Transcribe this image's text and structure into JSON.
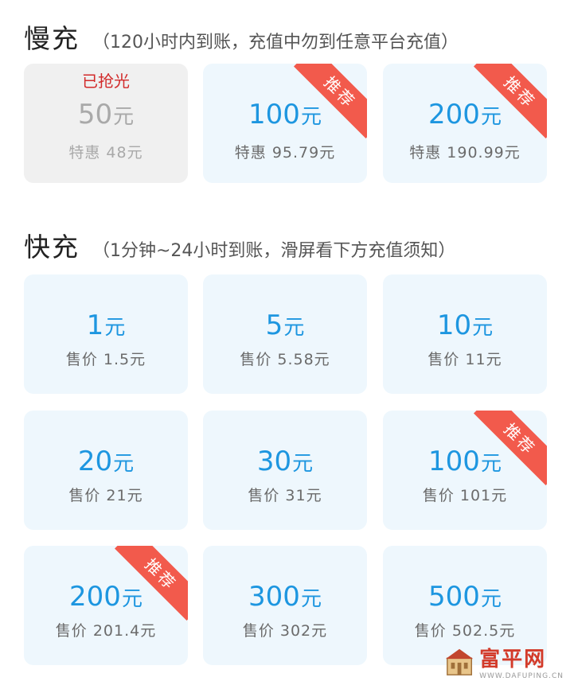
{
  "slow": {
    "title": "慢充",
    "note": "（120小时内到账，充值中勿到任意平台充值）",
    "cards": [
      {
        "amount": "50",
        "unit": "元",
        "price": "特惠  48元",
        "badge": "已抢光"
      },
      {
        "amount": "100",
        "unit": "元",
        "price": "特惠  95.79元",
        "ribbon": "推荐"
      },
      {
        "amount": "200",
        "unit": "元",
        "price": "特惠  190.99元",
        "ribbon": "推荐"
      }
    ]
  },
  "fast": {
    "title": "快充",
    "note": "（1分钟~24小时到账，滑屏看下方充值须知）",
    "cards": [
      {
        "amount": "1",
        "unit": "元",
        "price": "售价  1.5元"
      },
      {
        "amount": "5",
        "unit": "元",
        "price": "售价  5.58元"
      },
      {
        "amount": "10",
        "unit": "元",
        "price": "售价  11元"
      },
      {
        "amount": "20",
        "unit": "元",
        "price": "售价  21元"
      },
      {
        "amount": "30",
        "unit": "元",
        "price": "售价  31元"
      },
      {
        "amount": "100",
        "unit": "元",
        "price": "售价  101元",
        "ribbon": "推荐"
      },
      {
        "amount": "200",
        "unit": "元",
        "price": "售价  201.4元",
        "ribbon": "推荐"
      },
      {
        "amount": "300",
        "unit": "元",
        "price": "售价  302元"
      },
      {
        "amount": "500",
        "unit": "元",
        "price": "售价  502.5元"
      }
    ]
  },
  "watermark": {
    "title": "富平网",
    "subtitle": "WWW.DAFUPING.CN",
    "icon": "building-icon"
  },
  "colors": {
    "accent": "#1d96e0",
    "ribbon": "#f25a4c",
    "card_bg": "#eef7fd",
    "soldout": "#d22a2a",
    "disabled_text": "#a9a9a9"
  }
}
